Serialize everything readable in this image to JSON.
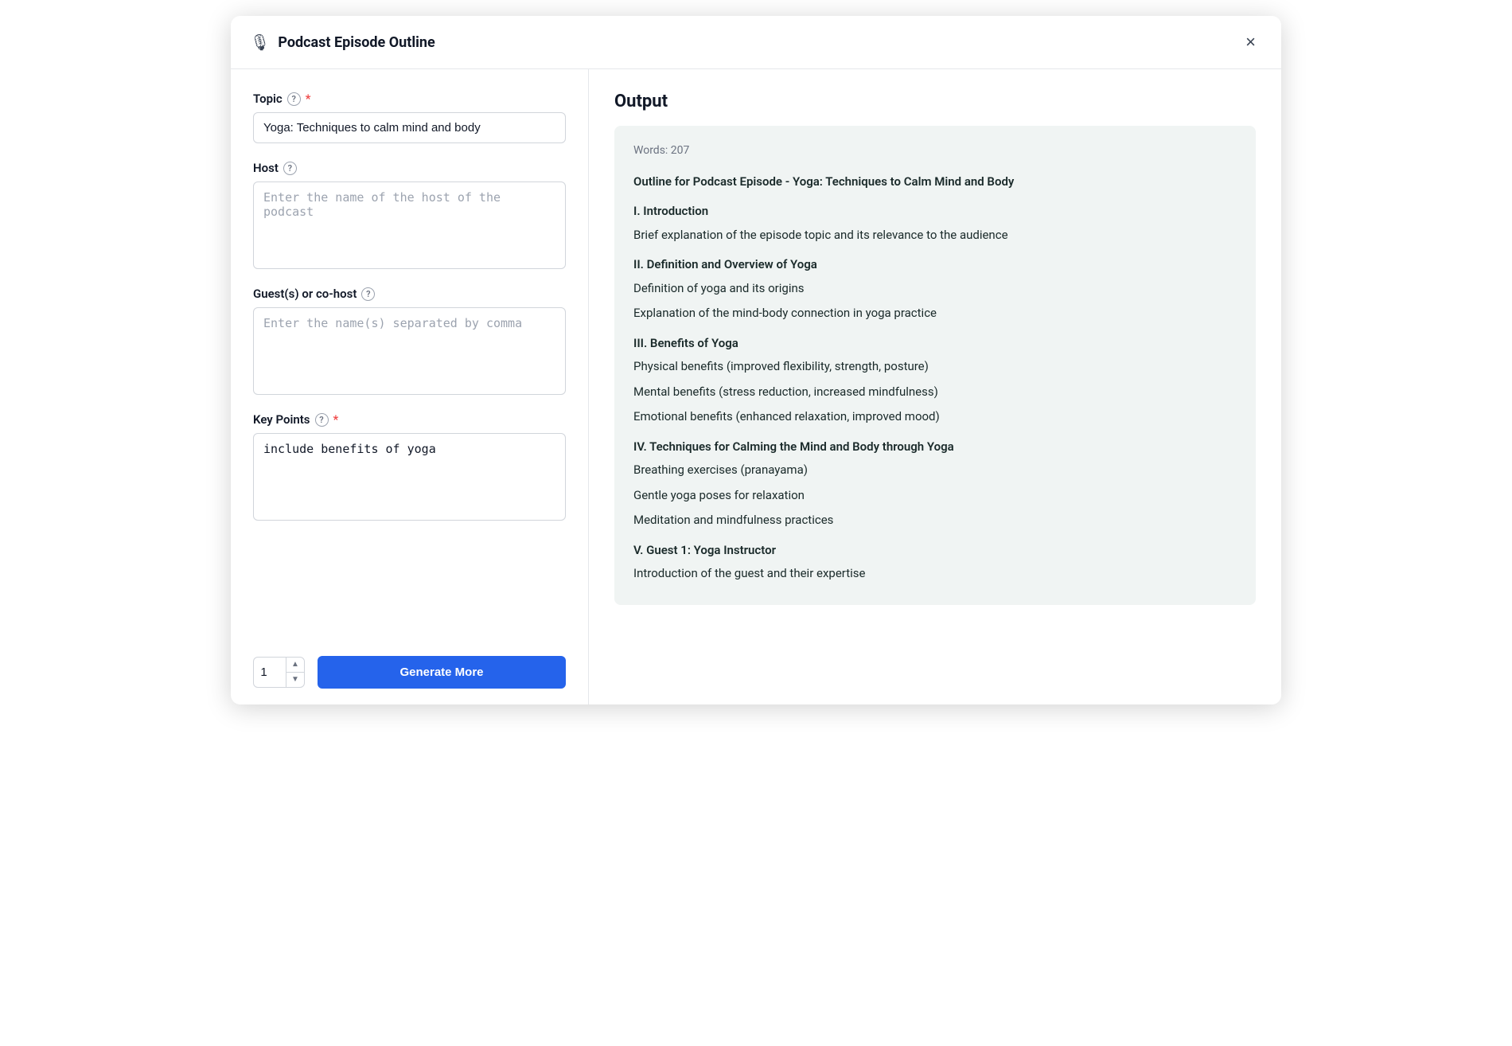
{
  "modal": {
    "title": "Podcast Episode Outline",
    "close_label": "×"
  },
  "left_panel": {
    "topic_label": "Topic",
    "topic_required": true,
    "topic_value": "Yoga: Techniques to calm mind and body",
    "topic_placeholder": "Yoga: Techniques to calm mind and body",
    "host_label": "Host",
    "host_placeholder": "Enter the name of the host of the podcast",
    "host_value": "",
    "guests_label": "Guest(s) or co-host",
    "guests_placeholder": "Enter the name(s) separated by comma",
    "guests_value": "",
    "key_points_label": "Key Points",
    "key_points_required": true,
    "key_points_value": "include benefits of yoga",
    "key_points_placeholder": "",
    "number_value": "1",
    "generate_more_label": "Generate More"
  },
  "output": {
    "title": "Output",
    "words_label": "Words: 207",
    "lines": [
      {
        "text": "Outline for Podcast Episode - Yoga: Techniques to Calm Mind and Body",
        "type": "heading"
      },
      {
        "text": "I. Introduction",
        "type": "heading"
      },
      {
        "text": "Brief explanation of the episode topic and its relevance to the audience",
        "type": "normal"
      },
      {
        "text": "II. Definition and Overview of Yoga",
        "type": "heading"
      },
      {
        "text": "Definition of yoga and its origins",
        "type": "normal"
      },
      {
        "text": "Explanation of the mind-body connection in yoga practice",
        "type": "normal"
      },
      {
        "text": "III. Benefits of Yoga",
        "type": "heading"
      },
      {
        "text": "Physical benefits (improved flexibility, strength, posture)",
        "type": "normal"
      },
      {
        "text": "Mental benefits (stress reduction, increased mindfulness)",
        "type": "normal"
      },
      {
        "text": "Emotional benefits (enhanced relaxation, improved mood)",
        "type": "normal"
      },
      {
        "text": "IV. Techniques for Calming the Mind and Body through Yoga",
        "type": "heading"
      },
      {
        "text": "Breathing exercises (pranayama)",
        "type": "normal"
      },
      {
        "text": "Gentle yoga poses for relaxation",
        "type": "normal"
      },
      {
        "text": "Meditation and mindfulness practices",
        "type": "normal"
      },
      {
        "text": "V. Guest 1: Yoga Instructor",
        "type": "heading"
      },
      {
        "text": "Introduction of the guest and their expertise",
        "type": "normal"
      }
    ]
  },
  "icons": {
    "mic": "🎙",
    "help": "?",
    "chevron_up": "▲",
    "chevron_down": "▼"
  }
}
